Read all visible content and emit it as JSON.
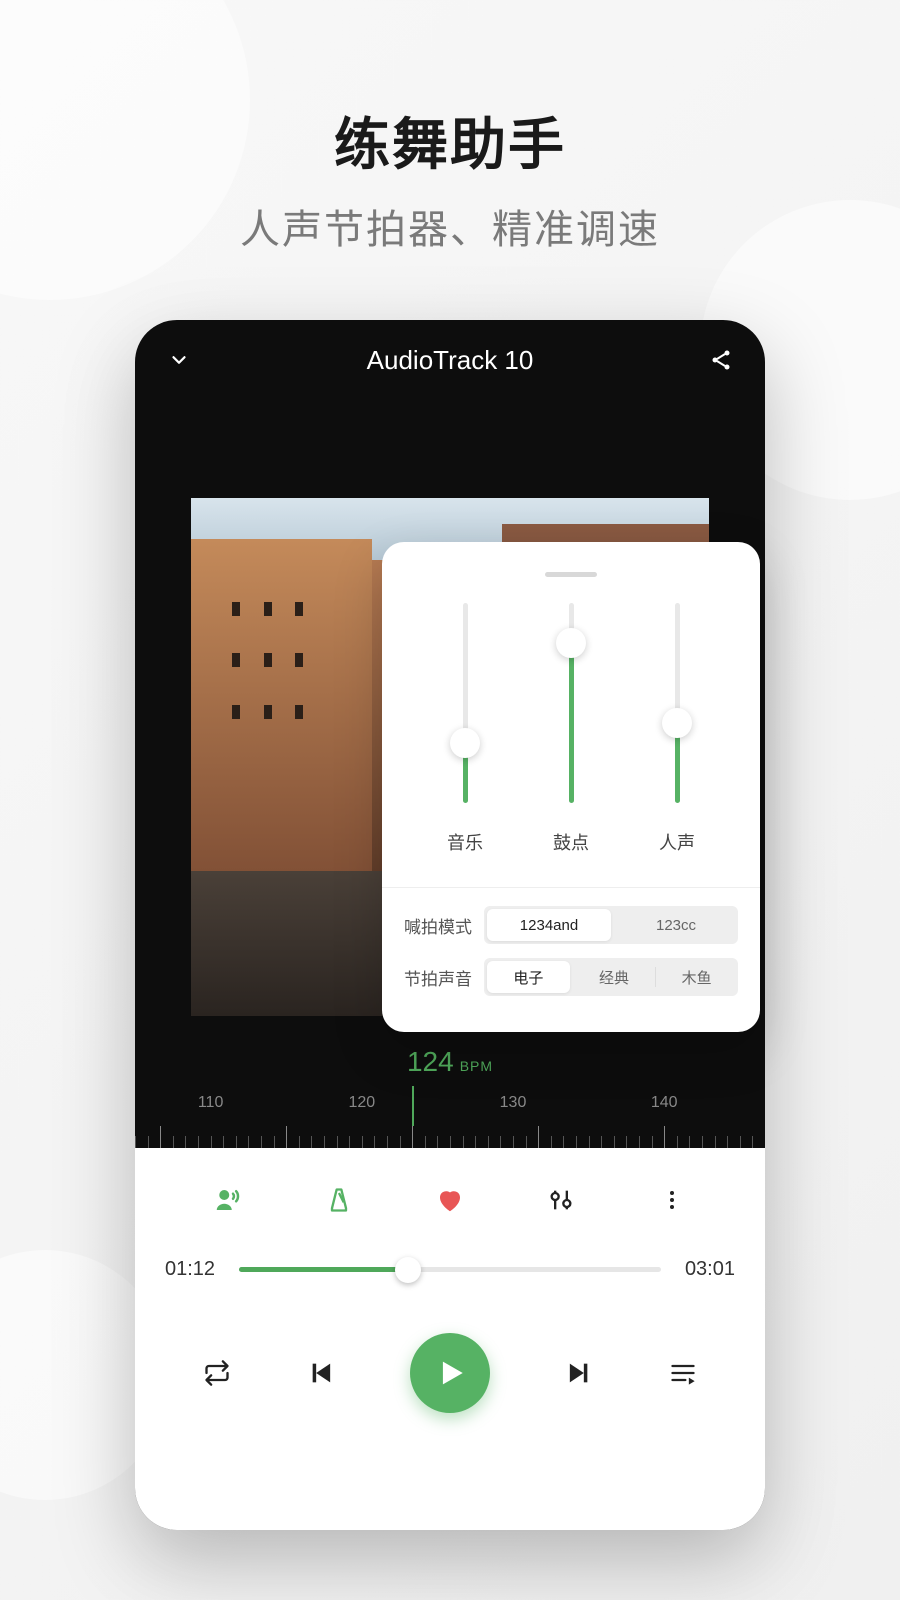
{
  "hero": {
    "title": "练舞助手",
    "subtitle": "人声节拍器、精准调速"
  },
  "player": {
    "track_title": "AudioTrack 10",
    "bpm_value": "124",
    "bpm_unit": "BPM",
    "ruler_labels": [
      "110",
      "120",
      "130",
      "140"
    ],
    "elapsed": "01:12",
    "total": "03:01",
    "progress_pct": 40
  },
  "popup": {
    "sliders": [
      {
        "label": "音乐",
        "value_pct": 30
      },
      {
        "label": "鼓点",
        "value_pct": 80
      },
      {
        "label": "人声",
        "value_pct": 40
      }
    ],
    "mode": {
      "label": "喊拍模式",
      "options": [
        "1234and",
        "123cc"
      ],
      "active_index": 0
    },
    "sound": {
      "label": "节拍声音",
      "options": [
        "电子",
        "经典",
        "木鱼"
      ],
      "active_index": 0
    }
  },
  "colors": {
    "accent": "#56b264"
  }
}
